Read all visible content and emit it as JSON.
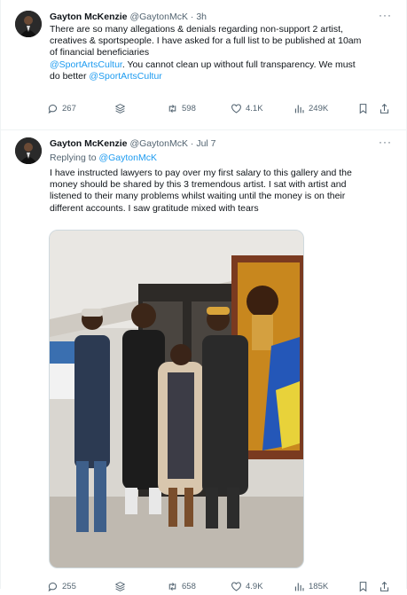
{
  "tweets": [
    {
      "author": "Gayton McKenzie",
      "handle": "@GaytonMcK",
      "sep": "·",
      "time": "3h",
      "more_icon": "···",
      "text_lines": [
        "There are so many allegations & denials regarding non-support 2 artist,",
        "creatives & sportspeople. I have asked for a full list to be published at 10am",
        "of financial beneficiaries"
      ],
      "mention_1": "@SportArtsCultur",
      "text_after_mention": ". You cannot clean up without full transparency. We must",
      "text_do_better": "do better",
      "mention_2": "@SportArtsCultur",
      "actions": {
        "replies": "267",
        "reposts": "598",
        "likes": "4.1K",
        "views": "249K"
      }
    },
    {
      "author": "Gayton McKenzie",
      "handle": "@GaytonMcK",
      "sep": "·",
      "time": "Jul 7",
      "more_icon": "···",
      "replying_prefix": "Replying to",
      "replying_to": "@GaytonMcK",
      "text_lines": [
        "I have instructed lawyers to pay over my first salary to this gallery and the",
        "money should be shared by this 3 tremendous artist. I sat with artist and",
        "listened to their many problems whilst waiting until the money is on their",
        "different accounts. I saw gratitude mixed with tears"
      ],
      "actions": {
        "replies": "255",
        "reposts": "658",
        "likes": "4.9K",
        "views": "185K"
      }
    }
  ],
  "icons": {
    "reply": "reply-icon",
    "grok": "grok-icon",
    "repost": "repost-icon",
    "like": "heart-icon",
    "views": "views-icon",
    "bookmark": "bookmark-icon",
    "share": "share-icon"
  },
  "colors": {
    "link": "#1d9bf0",
    "muted": "#536471",
    "text": "#0f1419",
    "border": "#eff3f4"
  }
}
